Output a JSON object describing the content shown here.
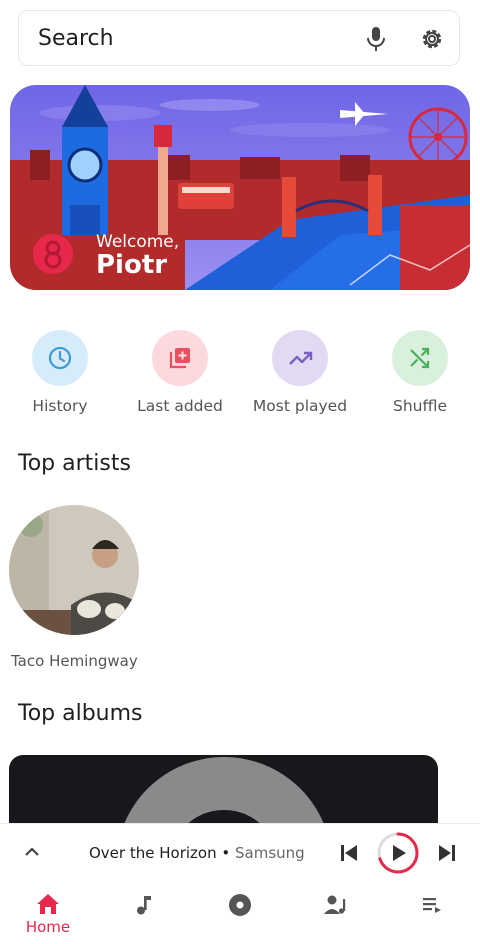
{
  "search": {
    "placeholder": "Search",
    "icons": [
      "mic-icon",
      "gear-icon"
    ]
  },
  "banner": {
    "welcome": "Welcome,",
    "username": "Piotr"
  },
  "quick_actions": [
    {
      "label": "History",
      "icon": "clock-icon",
      "bg": "#d7ecfb",
      "fg": "#3f9bd8"
    },
    {
      "label": "Last added",
      "icon": "library-add-icon",
      "bg": "#fcd9dc",
      "fg": "#e8505e"
    },
    {
      "label": "Most played",
      "icon": "trending-up-icon",
      "bg": "#e2d9f3",
      "fg": "#7b5fc0"
    },
    {
      "label": "Shuffle",
      "icon": "shuffle-icon",
      "bg": "#d9f0dc",
      "fg": "#4cae5b"
    }
  ],
  "sections": {
    "top_artists": "Top artists",
    "top_albums": "Top albums"
  },
  "artists": [
    {
      "name": "Taco Hemingway"
    }
  ],
  "player": {
    "song": "Over the Horizon",
    "separator": "•",
    "artist": "Samsung",
    "progress": 0.7
  },
  "nav": {
    "home_label": "Home"
  },
  "colors": {
    "accent": "#e8284b"
  }
}
